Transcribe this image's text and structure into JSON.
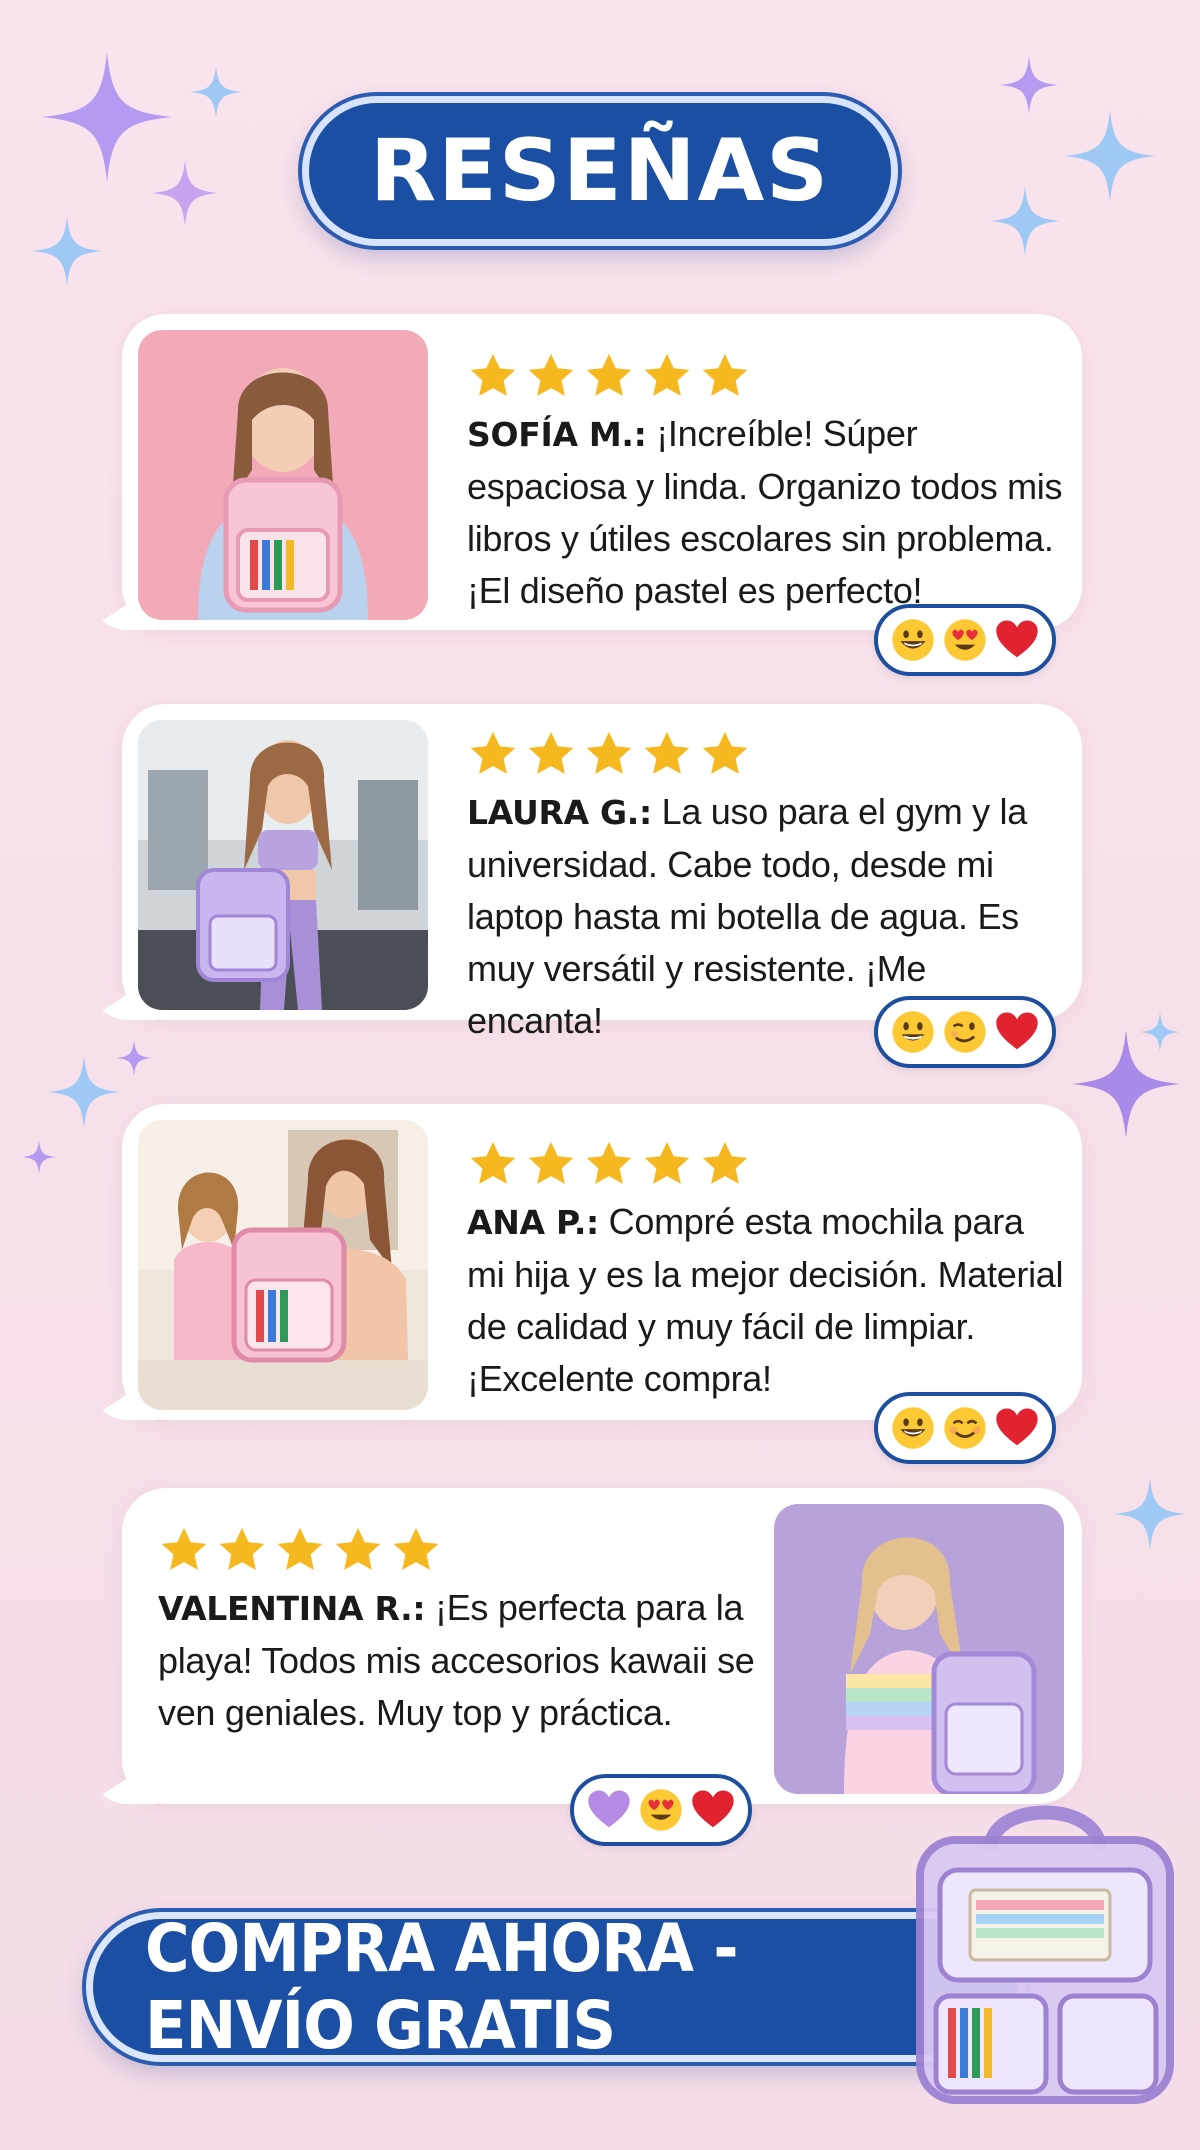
{
  "header": {
    "title": "RESEÑAS"
  },
  "reviews": [
    {
      "name": "SOFÍA M.:",
      "text": " ¡Increíble! Súper espaciosa y linda. Organizo todos mis libros y útiles escolares sin problema. ¡El diseño pastel es perfecto!",
      "rating": 5,
      "emojis": [
        "grinning-face",
        "heart-eyes-face",
        "red-heart"
      ]
    },
    {
      "name": "LAURA G.:",
      "text": " La uso para el gym y la universidad. Cabe todo, desde mi laptop hasta mi botella de agua. Es muy versátil y resistente. ¡Me encanta!",
      "rating": 5,
      "emojis": [
        "smiling-face",
        "winking-face",
        "red-heart"
      ]
    },
    {
      "name": "ANA P.:",
      "text": " Compré esta mochila para mi hija y es la mejor decisión. Material de calidad y muy fácil de limpiar. ¡Excelente compra!",
      "rating": 5,
      "emojis": [
        "grinning-face",
        "blushing-face",
        "red-heart"
      ]
    },
    {
      "name": "VALENTINA R.:",
      "text": " ¡Es perfecta para la playa! Todos mis accesorios kawaii se ven geniales. Muy top y práctica.",
      "rating": 5,
      "emojis": [
        "purple-heart",
        "heart-eyes-face",
        "red-heart"
      ]
    }
  ],
  "cta": {
    "label": "COMPRA AHORA - ENVÍO GRATIS"
  },
  "colors": {
    "brand_blue": "#1b4fa3",
    "star_gold": "#f6b81f",
    "background_pink": "#f9e3ec",
    "sparkle_purple": "#b79cf0",
    "sparkle_blue": "#9ec9f5"
  }
}
